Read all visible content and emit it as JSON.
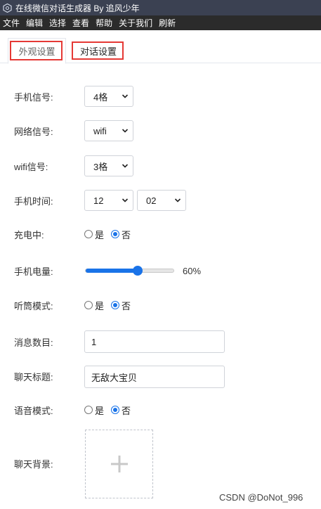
{
  "window": {
    "title": "在线微信对话生成器 By 追风少年"
  },
  "menu": [
    "文件",
    "编辑",
    "选择",
    "查看",
    "帮助",
    "关于我们",
    "刷新"
  ],
  "tabs": {
    "appearance": "外观设置",
    "dialog": "对话设置"
  },
  "highlight_color": "#e53935",
  "accent_color": "#1a73e8",
  "form": {
    "phone_signal": {
      "label": "手机信号:",
      "value": "4格"
    },
    "network_signal": {
      "label": "网络信号:",
      "value": "wifi"
    },
    "wifi_signal": {
      "label": "wifi信号:",
      "value": "3格"
    },
    "phone_time": {
      "label": "手机时间:",
      "hour": "12",
      "minute": "02"
    },
    "charging": {
      "label": "充电中:",
      "yes": "是",
      "no": "否",
      "selected": "no"
    },
    "battery": {
      "label": "手机电量:",
      "percent": 60,
      "display": "60%"
    },
    "earpiece_mode": {
      "label": "听筒模式:",
      "yes": "是",
      "no": "否",
      "selected": "no"
    },
    "message_count": {
      "label": "消息数目:",
      "value": "1"
    },
    "chat_title": {
      "label": "聊天标题:",
      "value": "无敌大宝贝"
    },
    "voice_mode": {
      "label": "语音模式:",
      "yes": "是",
      "no": "否",
      "selected": "no"
    },
    "chat_background": {
      "label": "聊天背景:",
      "icon": "plus-icon"
    }
  },
  "watermark": "CSDN @DoNot_996"
}
